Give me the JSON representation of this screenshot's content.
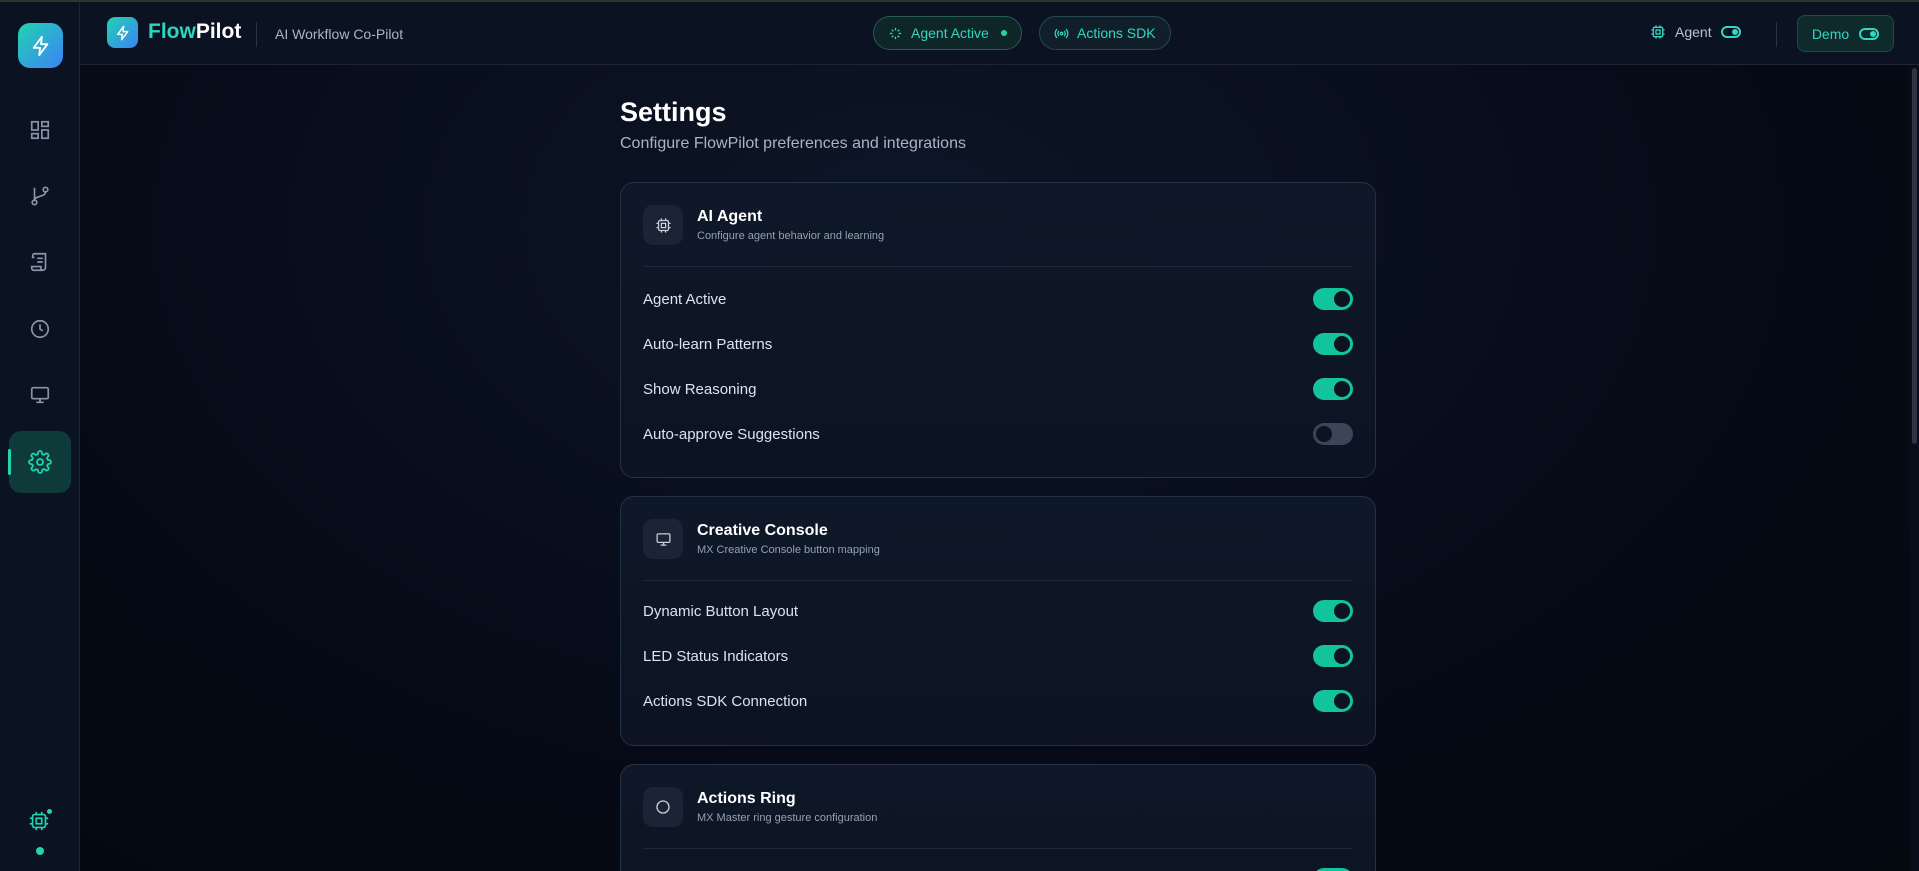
{
  "app": {
    "brand_flow": "Flow",
    "brand_pilot": "Pilot",
    "subtitle": "AI Workflow Co-Pilot"
  },
  "header": {
    "pill_agent_active": "Agent Active",
    "pill_actions_sdk": "Actions SDK",
    "agent_label": "Agent",
    "demo_label": "Demo"
  },
  "sidebar": {
    "items": [
      {
        "name": "dashboard",
        "icon": "grid-icon",
        "active": false
      },
      {
        "name": "workflows",
        "icon": "branch-icon",
        "active": false
      },
      {
        "name": "scripts",
        "icon": "scroll-icon",
        "active": false
      },
      {
        "name": "history",
        "icon": "clock-icon",
        "active": false
      },
      {
        "name": "console",
        "icon": "monitor-icon",
        "active": false
      },
      {
        "name": "settings",
        "icon": "gear-icon",
        "active": true
      }
    ]
  },
  "page": {
    "title": "Settings",
    "subtitle": "Configure FlowPilot preferences and integrations"
  },
  "cards": [
    {
      "title": "AI Agent",
      "desc": "Configure agent behavior and learning",
      "icon": "cpu-icon",
      "rows": [
        {
          "label": "Agent Active",
          "on": true
        },
        {
          "label": "Auto-learn Patterns",
          "on": true
        },
        {
          "label": "Show Reasoning",
          "on": true
        },
        {
          "label": "Auto-approve Suggestions",
          "on": false
        }
      ]
    },
    {
      "title": "Creative Console",
      "desc": "MX Creative Console button mapping",
      "icon": "monitor-icon",
      "rows": [
        {
          "label": "Dynamic Button Layout",
          "on": true
        },
        {
          "label": "LED Status Indicators",
          "on": true
        },
        {
          "label": "Actions SDK Connection",
          "on": true
        }
      ]
    },
    {
      "title": "Actions Ring",
      "desc": "MX Master ring gesture configuration",
      "icon": "circle-icon",
      "rows": []
    }
  ],
  "colors": {
    "accent": "#22d3b0",
    "background": "#050a17",
    "toggle_on": "#12c49b",
    "toggle_off": "#3b4557"
  }
}
